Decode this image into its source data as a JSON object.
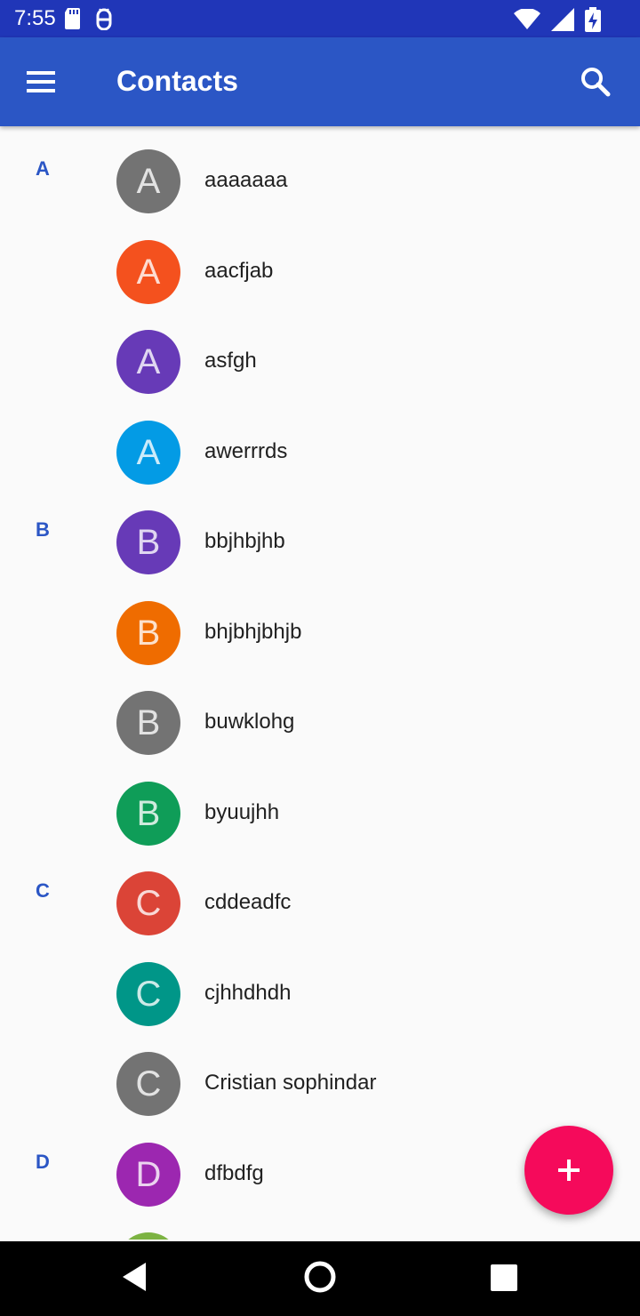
{
  "status_bar": {
    "time": "7:55",
    "left_icons": [
      "sd-card-icon",
      "android-debug-icon"
    ],
    "right_icons": [
      "wifi-icon",
      "signal-icon",
      "battery-charging-icon"
    ]
  },
  "app_bar": {
    "title": "Contacts",
    "menu_icon": "menu-icon",
    "search_icon": "search-icon",
    "color": "#2b56c5"
  },
  "contacts": [
    {
      "section": "A",
      "initial": "A",
      "name": "aaaaaaa",
      "color": "#737373"
    },
    {
      "section": "",
      "initial": "A",
      "name": "aacfjab",
      "color": "#f4511e"
    },
    {
      "section": "",
      "initial": "A",
      "name": "asfgh",
      "color": "#673ab7"
    },
    {
      "section": "",
      "initial": "A",
      "name": "awerrrds",
      "color": "#039be5"
    },
    {
      "section": "B",
      "initial": "B",
      "name": "bbjhbjhb",
      "color": "#673ab7"
    },
    {
      "section": "",
      "initial": "B",
      "name": "bhjbhjbhjb",
      "color": "#ef6c00"
    },
    {
      "section": "",
      "initial": "B",
      "name": "buwklohg",
      "color": "#737373"
    },
    {
      "section": "",
      "initial": "B",
      "name": "byuujhh",
      "color": "#0f9d58"
    },
    {
      "section": "C",
      "initial": "C",
      "name": "cddeadfc",
      "color": "#db4437"
    },
    {
      "section": "",
      "initial": "C",
      "name": "cjhhdhdh",
      "color": "#009688"
    },
    {
      "section": "",
      "initial": "C",
      "name": "Cristian sophindar",
      "color": "#737373"
    },
    {
      "section": "D",
      "initial": "D",
      "name": "dfbdfg",
      "color": "#9c27b0"
    },
    {
      "section": "",
      "initial": "",
      "name": "",
      "color": "#7cb342"
    }
  ],
  "fab": {
    "icon": "add-icon",
    "color": "#f50a5b"
  },
  "nav_bar": {
    "icons": [
      "back-icon",
      "home-icon",
      "recents-icon"
    ]
  }
}
